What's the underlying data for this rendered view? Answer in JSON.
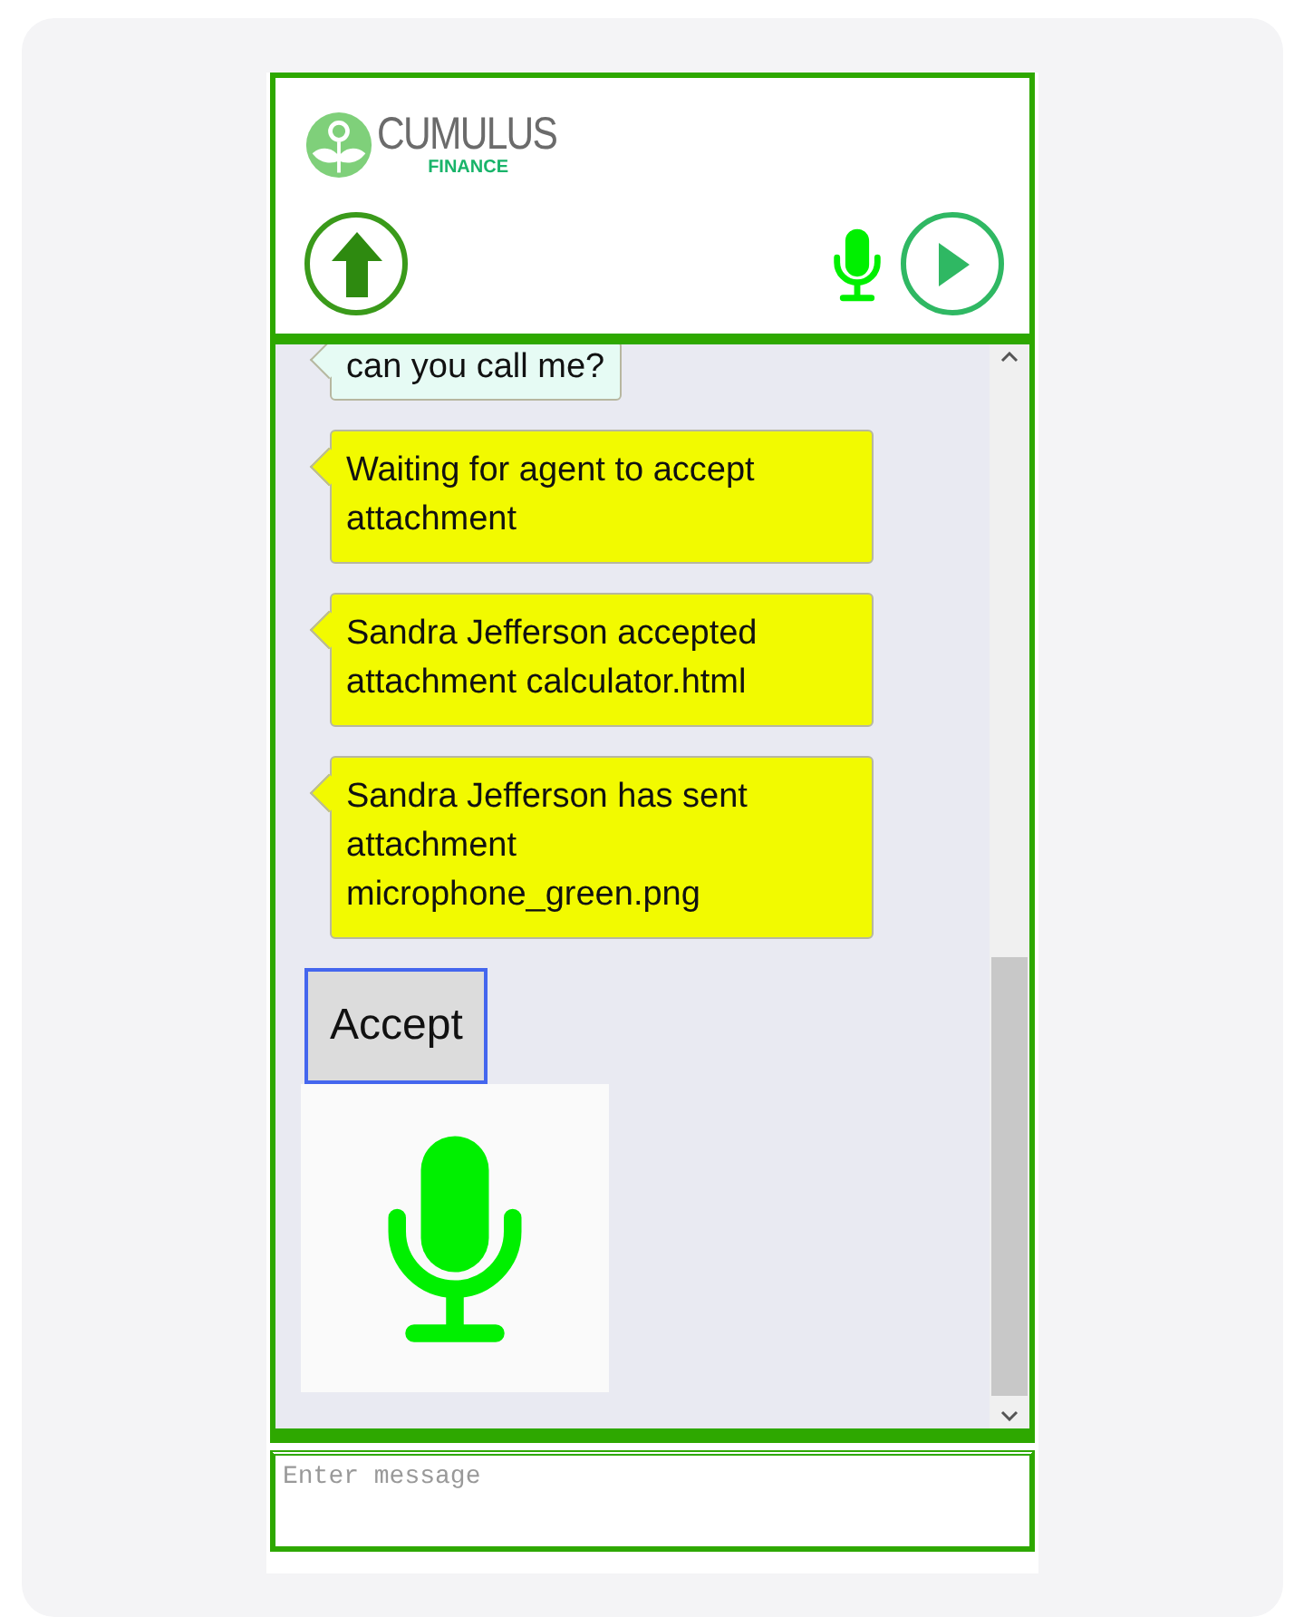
{
  "header": {
    "logo": {
      "name": "CUMULUS",
      "subtitle": "FINANCE"
    }
  },
  "messages": [
    {
      "kind": "user",
      "text": "can you call me?"
    },
    {
      "kind": "system",
      "text": "Waiting for agent to accept attachment"
    },
    {
      "kind": "system",
      "text": "Sandra Jefferson accepted attachment calculator.html"
    },
    {
      "kind": "system",
      "text": "Sandra Jefferson has sent attachment microphone_green.png"
    }
  ],
  "accept_button": "Accept",
  "composer": {
    "placeholder": "Enter message"
  }
}
